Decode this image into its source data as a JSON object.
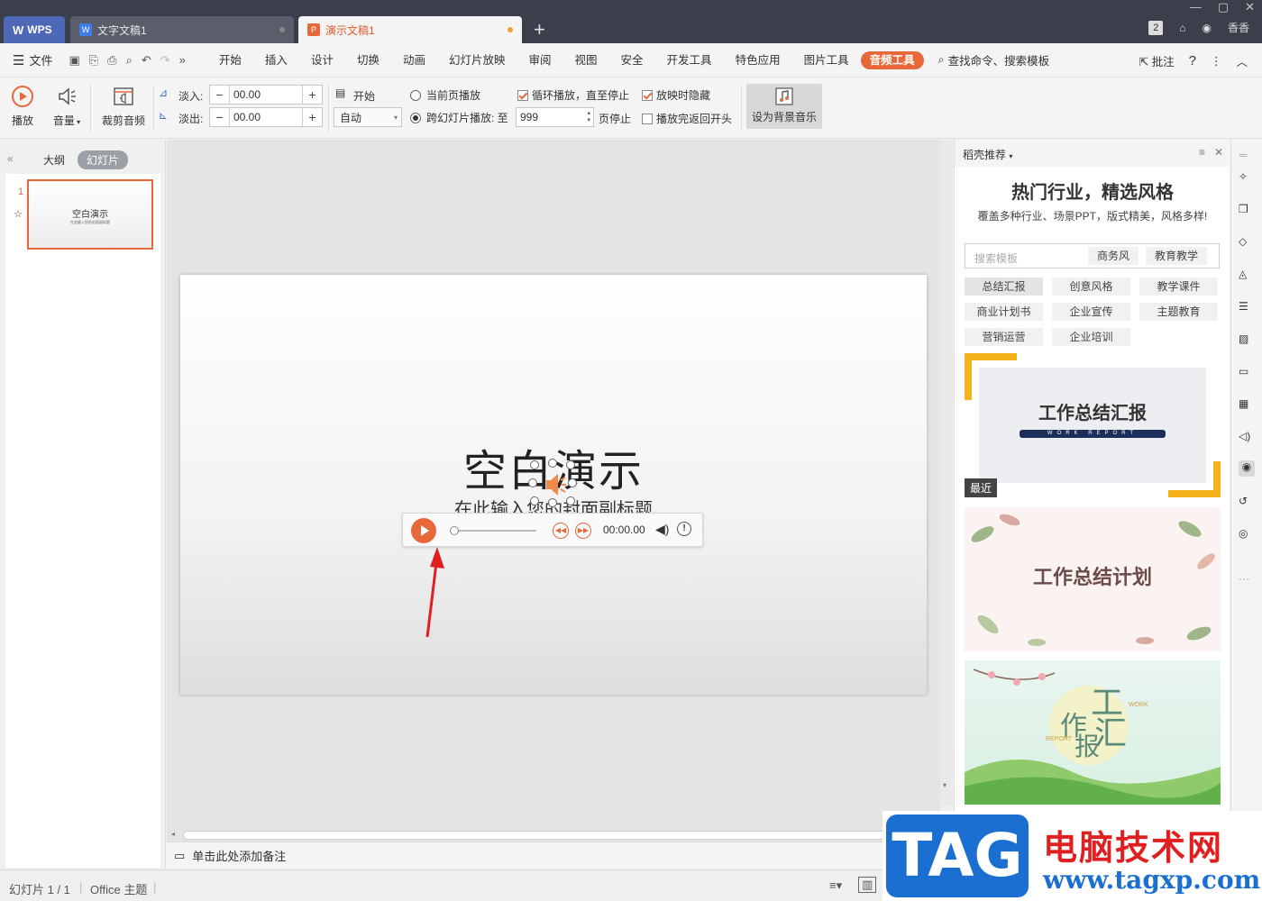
{
  "titlebar": {
    "tabs": [
      {
        "label": "WPS"
      },
      {
        "label": "文字文稿1"
      },
      {
        "label": "演示文稿1"
      }
    ],
    "tab_badge": "2",
    "user": "香香"
  },
  "menubar": {
    "file": "文件",
    "items": [
      "开始",
      "插入",
      "设计",
      "切换",
      "动画",
      "幻灯片放映",
      "审阅",
      "视图",
      "安全",
      "开发工具",
      "特色应用",
      "图片工具",
      "音频工具"
    ],
    "search": "查找命令、搜索模板",
    "comment": "批注",
    "help": "?"
  },
  "ribbon": {
    "play": "播放",
    "volume": "音量",
    "trim": "裁剪音频",
    "fade_in_label": "淡入:",
    "fade_in_value": "00.00",
    "fade_out_label": "淡出:",
    "fade_out_value": "00.00",
    "start_label": "开始",
    "start_value": "自动",
    "current_page": "当前页播放",
    "cross_slide": "跨幻灯片播放: 至",
    "cross_slide_value": "999",
    "page_stop": "页停止",
    "loop": "循环播放，直至停止",
    "hide_on_show": "放映时隐藏",
    "rewind": "播放完返回开头",
    "bg_music": "设为背景音乐"
  },
  "leftpanel": {
    "tab_outline": "大纲",
    "tab_slides": "幻灯片",
    "slide_number": "1",
    "thumb_title": "空白演示",
    "thumb_sub": "在此输入您的封面副标题"
  },
  "slide": {
    "title": "空白演示",
    "subtitle": "在此输入您的封面副标题",
    "player_time": "00:00.00"
  },
  "notes": {
    "placeholder": "单击此处添加备注"
  },
  "rpane": {
    "header": "稻壳推荐",
    "title": "热门行业，精选风格",
    "subtitle": "覆盖多种行业、场景PPT，版式精美，风格多样!",
    "search_placeholder": "搜索模板",
    "chips": [
      "商务风",
      "教育教学"
    ],
    "categories": [
      "总结汇报",
      "创意风格",
      "教学课件",
      "商业计划书",
      "企业宣传",
      "主题教育",
      "营销运营",
      "企业培训"
    ],
    "card1": {
      "title": "工作总结汇报",
      "banner": "WORK REPORT",
      "tag": "最近"
    },
    "card2": {
      "title": "工作总结计划"
    },
    "card3": {
      "chars": [
        "工",
        "作",
        "汇",
        "报"
      ],
      "en1": "WORK",
      "en2": "REPORT"
    }
  },
  "status": {
    "slide": "幻灯片 1 / 1",
    "theme": "Office 主题"
  },
  "watermark": {
    "tag": "TAG",
    "cn": "电脑技术网",
    "url": "www.tagxp.com"
  },
  "colors": {
    "accent": "#e8683a",
    "titlebar": "#3b3f4c",
    "wps_blue": "#4f68b5"
  }
}
